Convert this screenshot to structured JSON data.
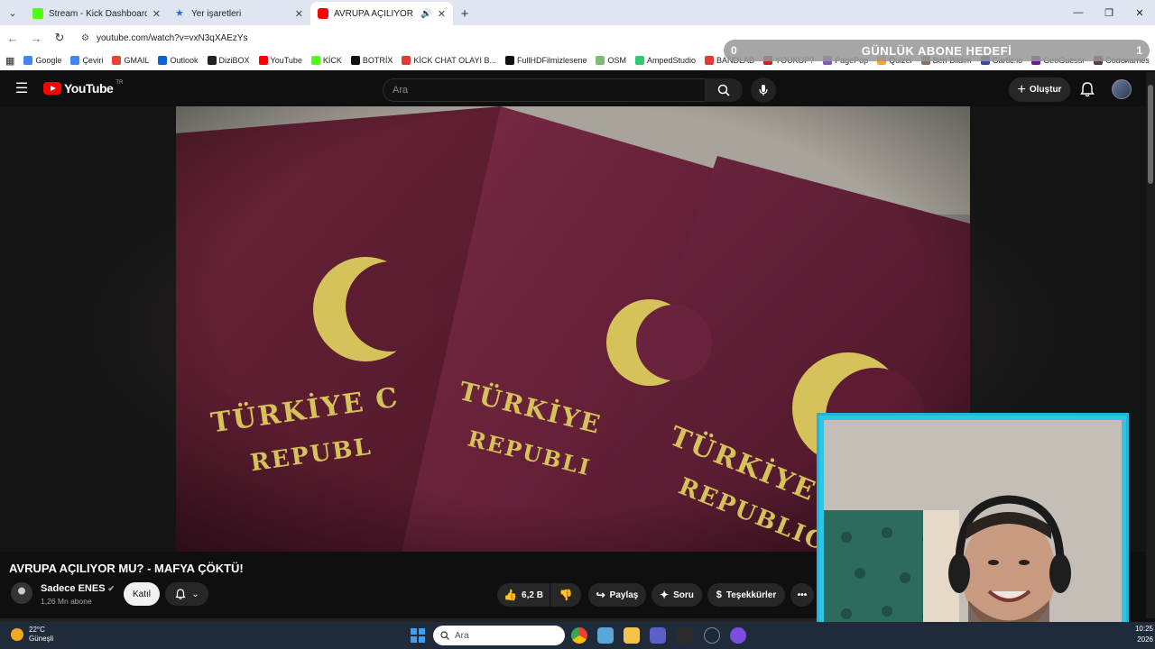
{
  "browser": {
    "tabs": [
      {
        "title": "Stream - Kick Dashboard",
        "icon": "kick-icon"
      },
      {
        "title": "Yer işaretleri",
        "icon": "star-icon"
      },
      {
        "title": "AVRUPA AÇILIYOR MU? - M",
        "icon": "youtube-icon"
      }
    ],
    "url": "youtube.com/watch?v=vxN3qXAEzYs",
    "bookmarks": [
      {
        "label": "Google",
        "color": "#4285f4"
      },
      {
        "label": "Çeviri",
        "color": "#4285f4"
      },
      {
        "label": "GMAIL",
        "color": "#ea4335"
      },
      {
        "label": "Outlook",
        "color": "#0a64d8"
      },
      {
        "label": "DiziBOX",
        "color": "#222222"
      },
      {
        "label": "YouTube",
        "color": "#ff0000"
      },
      {
        "label": "KİCK",
        "color": "#53fc18"
      },
      {
        "label": "BOTRİX",
        "color": "#111111"
      },
      {
        "label": "KİCK CHAT OLAYI B...",
        "color": "#e53935"
      },
      {
        "label": "FullHDFilmizlesene",
        "color": "#111111"
      },
      {
        "label": "OSM",
        "color": "#7ebc6f"
      },
      {
        "label": "AmpedStudio",
        "color": "#2ecc71"
      },
      {
        "label": "BANDLAB",
        "color": "#e53935"
      },
      {
        "label": "YOUKUP?",
        "color": "#c62828"
      },
      {
        "label": "PagePop",
        "color": "#7e57c2"
      },
      {
        "label": "Quizei",
        "color": "#f9a825"
      },
      {
        "label": "Ben Bildim",
        "color": "#8d6e63"
      },
      {
        "label": "Gartic.io",
        "color": "#3949ab"
      },
      {
        "label": "GeoGuessr",
        "color": "#6a1b9a"
      },
      {
        "label": "Codenames",
        "color": "#5d4037"
      }
    ]
  },
  "overlay": {
    "left_value": "0",
    "label": "GÜNLÜK ABONE HEDEFİ",
    "right_value": "1"
  },
  "youtube": {
    "logo_text": "YouTube",
    "country_code": "TR",
    "search_placeholder": "Ara",
    "create_label": "Oluştur",
    "video_title": "AVRUPA AÇILIYOR MU? - MAFYA ÇÖKTÜ!",
    "channel_name": "Sadece ENES",
    "subscribers": "1,26 Mn abone",
    "join_label": "Katıl",
    "likes": "6,2 B",
    "share_label": "Paylaş",
    "ask_label": "Soru",
    "thanks_label": "Teşekkürler",
    "passport_text_1": "TÜRKİYE C",
    "passport_text_2": "REPUBL",
    "passport_text_3": "TÜRKİYE",
    "passport_text_4": "REPUBLI",
    "passport_text_5": "TÜRKİYE CU",
    "passport_text_6": "REPUBLIC"
  },
  "taskbar": {
    "temperature": "22°C",
    "weather": "Güneşli",
    "search_placeholder": "Ara",
    "time": "10:25",
    "year": "2026"
  }
}
